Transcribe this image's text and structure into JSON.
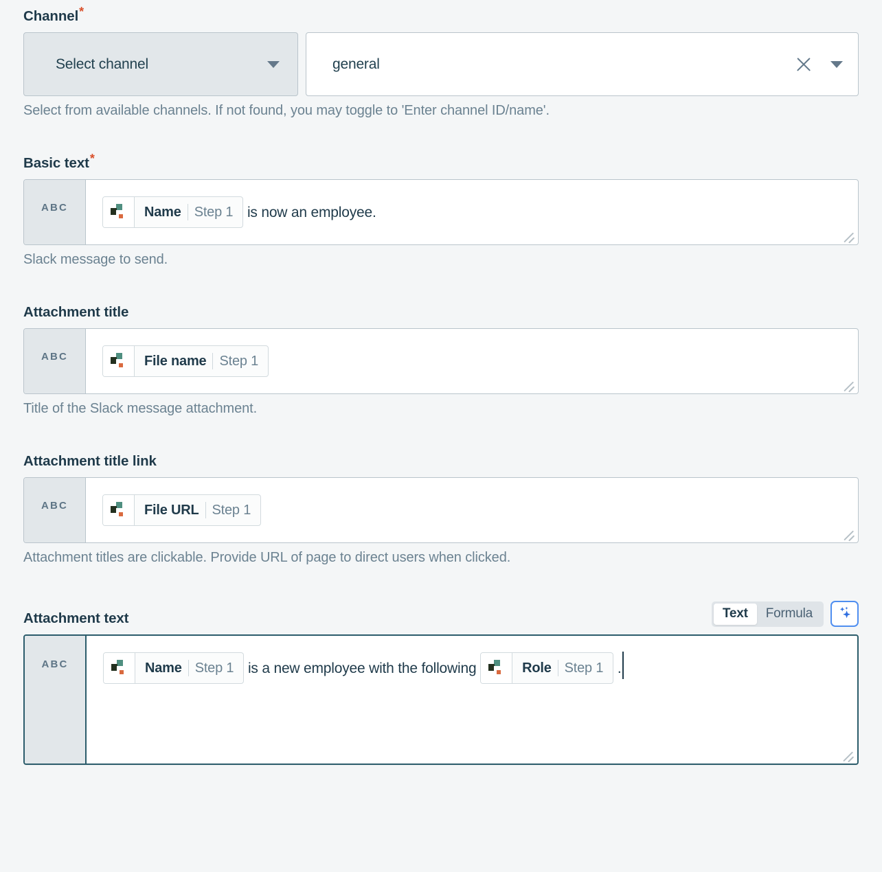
{
  "chip_icon_name": "step-source-icon",
  "colors": {
    "required_star": "#d9502b",
    "label": "#1f3a4a",
    "help": "#6b8291",
    "focus_border": "#2b5c6b",
    "ai_accent": "#4f8ef0",
    "chip_green": "#4f8f80",
    "chip_dark": "#23301f",
    "chip_orange": "#d96a3f",
    "page_bg": "#f4f6f7"
  },
  "channel": {
    "label": "Channel",
    "required_marker": "*",
    "select_button_label": "Select channel",
    "selected_value": "general",
    "clear_icon": "close-icon",
    "dropdown_icon": "chevron-down-icon",
    "help": "Select from available channels. If not found, you may toggle to 'Enter channel ID/name'."
  },
  "basic_text": {
    "label": "Basic text",
    "required_marker": "*",
    "prefix_badge": "ABC",
    "chip": {
      "name": "Name",
      "step": "Step 1"
    },
    "trailing_text": " is now an employee.",
    "help": "Slack message to send."
  },
  "attachment_title": {
    "label": "Attachment title",
    "prefix_badge": "ABC",
    "chip": {
      "name": "File name",
      "step": "Step 1"
    },
    "trailing_text": "",
    "help": "Title of the Slack message attachment."
  },
  "attachment_title_link": {
    "label": "Attachment title link",
    "prefix_badge": "ABC",
    "chip": {
      "name": "File URL",
      "step": "Step 1"
    },
    "trailing_text": "",
    "help": "Attachment titles are clickable. Provide URL of page to direct users when clicked."
  },
  "attachment_text": {
    "label": "Attachment text",
    "prefix_badge": "ABC",
    "mode_toggle": {
      "text_label": "Text",
      "formula_label": "Formula",
      "selected": "Text",
      "ai_button_icon": "sparkles-icon"
    },
    "chip_1": {
      "name": "Name",
      "step": "Step 1"
    },
    "middle_text": " is a new employee with the following ",
    "chip_2": {
      "name": "Role",
      "step": "Step 1"
    },
    "end_text": " ."
  }
}
